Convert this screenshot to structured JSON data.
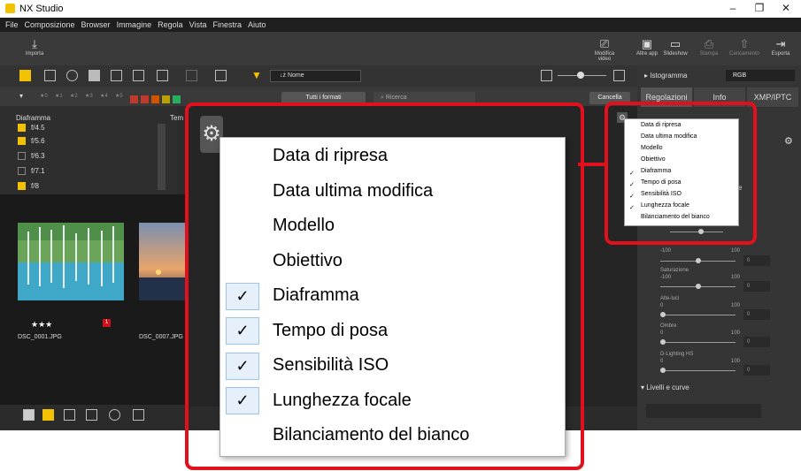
{
  "window": {
    "title": "NX Studio",
    "minimize": "–",
    "maximize": "❐",
    "close": "✕"
  },
  "menu": [
    "File",
    "Composizione",
    "Browser",
    "Immagine",
    "Regola",
    "Vista",
    "Finestra",
    "Aiuto"
  ],
  "toolbar": {
    "import_label": "Importa",
    "items": [
      "Modifica video",
      "Altre app",
      "Slideshow",
      "Stampa",
      "Caricamento",
      "Esporta"
    ]
  },
  "browser_bar": {
    "sort_value": "Nome",
    "sort_prefix": "↓ż",
    "rating_filters": [
      "★0",
      "★1",
      "★2",
      "★3",
      "★4",
      "★5"
    ],
    "format_button": "Tutti i formati",
    "search_placeholder": "Ricerca",
    "cancel_button": "Cancella"
  },
  "filter_panel": {
    "col1_header": "Diaframma",
    "col2_header": "Tem",
    "items": [
      {
        "label": "f/4.5",
        "checked": true
      },
      {
        "label": "f/5.6",
        "checked": true
      },
      {
        "label": "f/6.3",
        "checked": false
      },
      {
        "label": "f/7.1",
        "checked": false
      },
      {
        "label": "f/8",
        "checked": true
      }
    ]
  },
  "thumbnails": [
    {
      "name": "DSC_0001.JPG",
      "rating": "★★★",
      "badge": "1"
    },
    {
      "name": "DSC_0007.JPG",
      "rating": "",
      "badge": ""
    }
  ],
  "right_panel": {
    "histogram_label": "Istogramma",
    "channel": "RGB",
    "tabs": [
      "Regolazioni",
      "Info",
      "XMP/IPTC"
    ],
    "sliders": [
      {
        "label": "",
        "min": "-100",
        "max": "100",
        "value": "0",
        "level": 0.5
      },
      {
        "label": "Saturazione",
        "min": "-100",
        "max": "100",
        "value": "0",
        "level": 0.5
      },
      {
        "label": "Alte-luci",
        "min": "0",
        "max": "100",
        "value": "0",
        "level": 0
      },
      {
        "label": "Ombre",
        "min": "0",
        "max": "100",
        "value": "0",
        "level": 0
      },
      {
        "label": "D-Lighting HS",
        "min": "0",
        "max": "100",
        "value": "0",
        "level": 0
      }
    ],
    "section": "Livelli e curve",
    "partial_label": "e"
  },
  "small_menu": {
    "items": [
      {
        "label": "Data di ripresa",
        "checked": false
      },
      {
        "label": "Data ultima modifica",
        "checked": false
      },
      {
        "label": "Modello",
        "checked": false
      },
      {
        "label": "Obiettivo",
        "checked": false
      },
      {
        "label": "Diaframma",
        "checked": true
      },
      {
        "label": "Tempo di posa",
        "checked": true
      },
      {
        "label": "Sensibilità ISO",
        "checked": true
      },
      {
        "label": "Lunghezza focale",
        "checked": true
      },
      {
        "label": "Bilanciamento del bianco",
        "checked": false
      }
    ]
  },
  "big_menu": {
    "check_glyph": "✓",
    "items": [
      {
        "label": "Data di ripresa",
        "checked": false
      },
      {
        "label": "Data ultima modifica",
        "checked": false
      },
      {
        "label": "Modello",
        "checked": false
      },
      {
        "label": "Obiettivo",
        "checked": false
      },
      {
        "label": "Diaframma",
        "checked": true
      },
      {
        "label": "Tempo di posa",
        "checked": true
      },
      {
        "label": "Sensibilità ISO",
        "checked": true
      },
      {
        "label": "Lunghezza focale",
        "checked": true
      },
      {
        "label": "Bilanciamento del bianco",
        "checked": false
      }
    ]
  },
  "colors": {
    "highlight_red": "#e2101c",
    "accent_yellow": "#f2c100",
    "check_bg": "#e6f0fa"
  }
}
